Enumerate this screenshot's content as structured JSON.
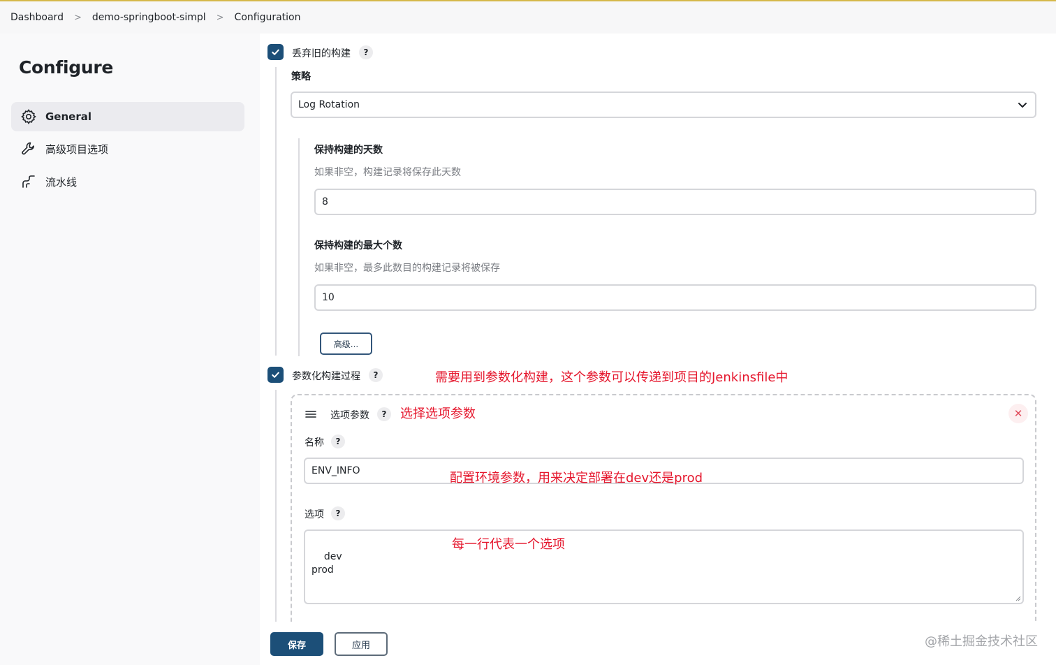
{
  "breadcrumb": {
    "items": [
      "Dashboard",
      "demo-springboot-simpl",
      "Configuration"
    ]
  },
  "sidebar": {
    "title": "Configure",
    "items": [
      {
        "label": "General",
        "icon": "gear-icon",
        "active": true
      },
      {
        "label": "高级项目选项",
        "icon": "wrench-icon",
        "active": false
      },
      {
        "label": "流水线",
        "icon": "pipeline-icon",
        "active": false
      }
    ]
  },
  "discard": {
    "label": "丢弃旧的构建",
    "checked": true,
    "help": "?",
    "strategy_label": "策略",
    "strategy_value": "Log Rotation",
    "days_label": "保持构建的天数",
    "days_desc": "如果非空，构建记录将保存此天数",
    "days_value": "8",
    "max_label": "保持构建的最大个数",
    "max_desc": "如果非空，最多此数目的构建记录将被保存",
    "max_value": "10",
    "advanced_button": "高级..."
  },
  "params": {
    "label": "参数化构建过程",
    "checked": true,
    "help": "?",
    "note": "需要用到参数化构建，这个参数可以传递到项目的Jenkinsfile中",
    "choice": {
      "title": "选项参数",
      "help": "?",
      "note": "选择选项参数",
      "close": "✕",
      "name_label": "名称",
      "name_help": "?",
      "name_value": "ENV_INFO",
      "name_note": "配置环境参数，用来决定部署在dev还是prod",
      "choices_label": "选项",
      "choices_help": "?",
      "choices_value": "dev\nprod",
      "choices_note": "每一行代表一个选项"
    }
  },
  "footer": {
    "save": "保存",
    "apply": "应用",
    "watermark": "@稀土掘金技术社区"
  },
  "colors": {
    "primary": "#1c4f78",
    "annotation": "#e5172d"
  }
}
